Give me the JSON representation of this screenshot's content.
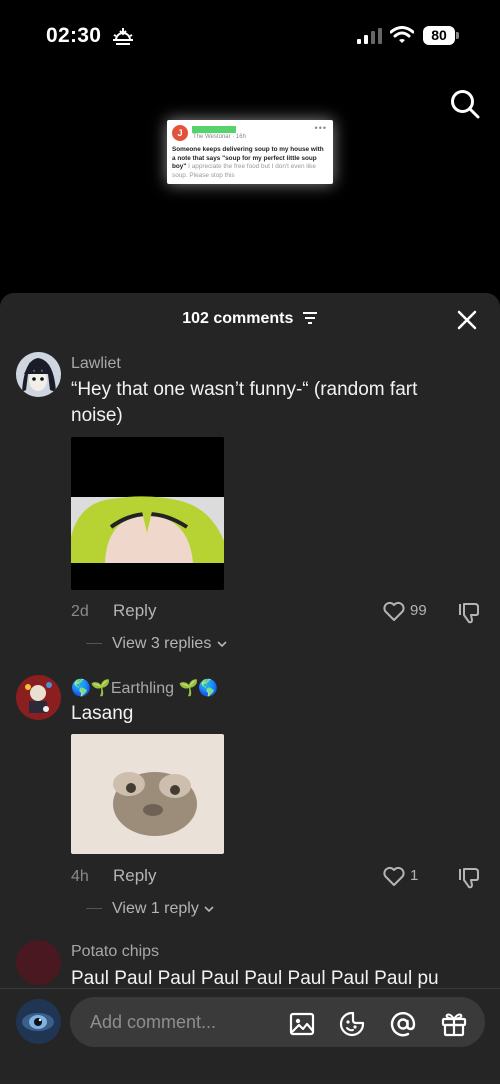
{
  "status_bar": {
    "time": "02:30",
    "battery": "80"
  },
  "post_preview": {
    "avatar_letter": "J",
    "meta": "The Westonar · 16h",
    "text_bold_1": "Someone keeps delivering soup to my house with a note that says \"soup for my perfect little soup boy\"",
    "text_faint": " I appreciate the free food but I don't even like soup. Please stop this"
  },
  "sheet": {
    "comments_count": "102 comments"
  },
  "comments": [
    {
      "username": "Lawliet",
      "text": "“Hey that one wasn’t funny-“ (random fart noise)",
      "age": "2d",
      "reply_label": "Reply",
      "likes": "99",
      "view_replies": "View 3 replies"
    },
    {
      "username": "🌎🌱Earthling 🌱🌎",
      "text": "Lasang",
      "age": "4h",
      "reply_label": "Reply",
      "likes": "1",
      "view_replies": "View 1 reply"
    },
    {
      "username": "Potato chips",
      "text": "Paul Paul Paul Paul Paul Paul Paul Paul pu"
    }
  ],
  "input": {
    "placeholder": "Add comment..."
  },
  "colors": {
    "sheet_bg": "#252525",
    "input_bg": "#3a3a3a",
    "post_avatar": "#e2533b",
    "post_name_highlight": "#56d36b"
  },
  "icons": [
    "sun-icon",
    "signal-icon",
    "wifi-icon",
    "search-icon",
    "filter-icon",
    "close-icon",
    "heart-icon",
    "dislike-icon",
    "chevron-down-icon",
    "image-icon",
    "emoji-icon",
    "mention-icon",
    "gift-icon"
  ]
}
